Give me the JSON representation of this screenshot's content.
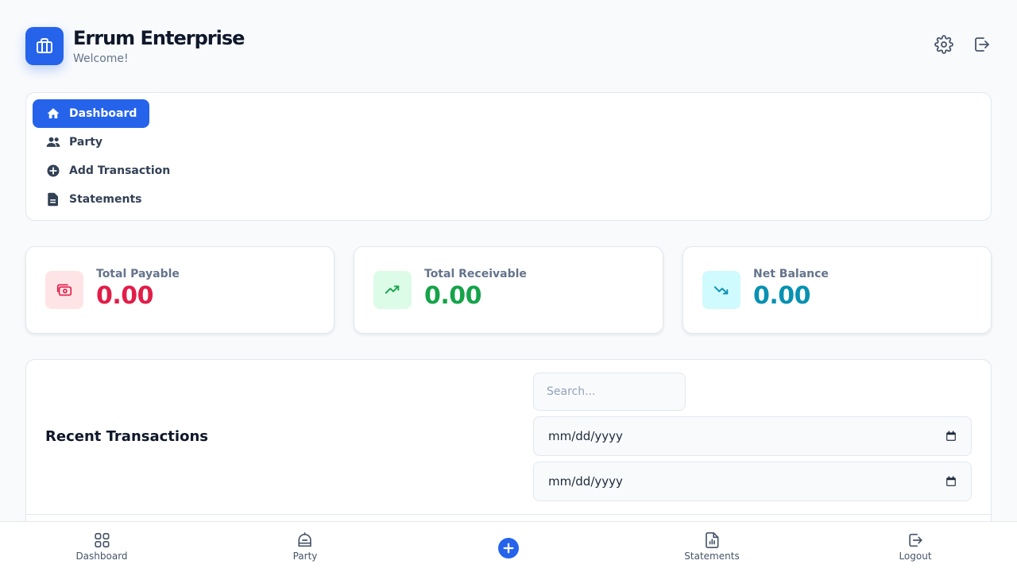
{
  "header": {
    "title": "Errum Enterprise",
    "subtitle": "Welcome!",
    "logo_icon": "briefcase-icon",
    "settings_icon": "gear-icon",
    "logout_icon": "logout-icon"
  },
  "nav": {
    "items": [
      {
        "label": "Dashboard",
        "icon": "home-icon",
        "active": true
      },
      {
        "label": "Party",
        "icon": "users-icon",
        "active": false
      },
      {
        "label": "Add Transaction",
        "icon": "plus-circle-icon",
        "active": false
      },
      {
        "label": "Statements",
        "icon": "document-icon",
        "active": false
      }
    ]
  },
  "stats": [
    {
      "label": "Total Payable",
      "currency_glyph": "",
      "amount": "0.00",
      "color": "#e11d48",
      "bg": "#ffe4e6",
      "icon": "cash-icon"
    },
    {
      "label": "Total Receivable",
      "currency_glyph": "",
      "amount": "0.00",
      "color": "#16a34a",
      "bg": "#dcfce7",
      "icon": "trending-up-icon"
    },
    {
      "label": "Net Balance",
      "currency_glyph": "",
      "amount": "0.00",
      "color": "#0891b2",
      "bg": "#cffafe",
      "icon": "trending-down-icon"
    }
  ],
  "transactions": {
    "title": "Recent Transactions",
    "search_placeholder": "Search...",
    "date_from": "mm/dd/yyyy",
    "date_to": "mm/dd/yyyy",
    "calendar_icon": "calendar-icon"
  },
  "bottom_nav": [
    {
      "label": "Dashboard",
      "icon": "grid-icon"
    },
    {
      "label": "Party",
      "icon": "party-icon"
    },
    {
      "label": "",
      "icon": "plus-circle-icon"
    },
    {
      "label": "Statements",
      "icon": "report-icon"
    },
    {
      "label": "Logout",
      "icon": "logout-icon"
    }
  ],
  "colors": {
    "accent": "#2563eb",
    "text": "#0f172a",
    "muted": "#64748b",
    "border": "#e2e8f0"
  }
}
